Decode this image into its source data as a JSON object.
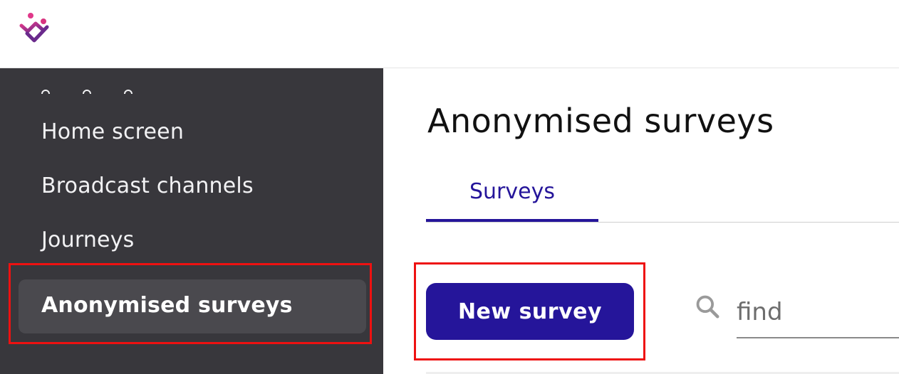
{
  "header": {
    "logo_icon": "app-logo-icon"
  },
  "sidebar": {
    "items": [
      {
        "label": "Home screen"
      },
      {
        "label": "Broadcast channels"
      },
      {
        "label": "Journeys"
      },
      {
        "label": "Anonymised surveys",
        "active": true
      }
    ]
  },
  "main": {
    "title": "Anonymised surveys",
    "tabs": [
      {
        "label": "Surveys",
        "active": true
      }
    ],
    "new_button_label": "New survey",
    "search": {
      "placeholder": "find",
      "value": "",
      "icon": "search-icon"
    }
  },
  "colors": {
    "brand": "#25159a",
    "sidebar_bg": "#38373c",
    "sidebar_active_bg": "#4a494e",
    "highlight": "#ee1111"
  }
}
